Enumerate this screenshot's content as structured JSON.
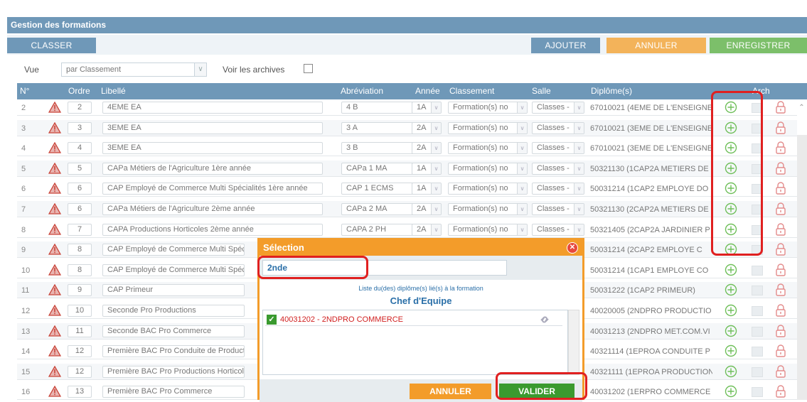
{
  "header": {
    "title": "Gestion des formations"
  },
  "toolbar": {
    "classer_label": "CLASSER",
    "ajouter_label": "AJOUTER",
    "annuler_label": "ANNULER",
    "enregistrer_label": "ENREGISTRER",
    "colors": {
      "classer": "#6f98b8",
      "ajouter": "#6f98b8",
      "annuler": "#f3b35a",
      "enregistrer": "#7cbf6a"
    }
  },
  "view": {
    "vue_label": "Vue",
    "vue_value": "par Classement",
    "archives_label": "Voir les archives",
    "archives_checked": false
  },
  "table": {
    "columns": [
      "N°",
      "Ordre",
      "Libellé",
      "Abréviation",
      "Année",
      "Classement",
      "Salle",
      "Diplôme(s)",
      "Arch"
    ],
    "rows": [
      {
        "n": "2",
        "ordre": "2",
        "libelle": "4EME EA",
        "abrev": "4 B",
        "annee": "1A",
        "classement": "Formation(s) no",
        "salle": "Classes -",
        "diplome": "67010021 (4EME DE L'ENSEIGNE"
      },
      {
        "n": "3",
        "ordre": "3",
        "libelle": "3EME EA",
        "abrev": "3 A",
        "annee": "2A",
        "classement": "Formation(s) no",
        "salle": "Classes -",
        "diplome": "67010021 (3EME DE L'ENSEIGNE"
      },
      {
        "n": "4",
        "ordre": "4",
        "libelle": "3EME EA",
        "abrev": "3 B",
        "annee": "2A",
        "classement": "Formation(s) no",
        "salle": "Classes -",
        "diplome": "67010021 (3EME DE L'ENSEIGNE"
      },
      {
        "n": "5",
        "ordre": "5",
        "libelle": "CAPa Métiers de l'Agriculture 1ère année",
        "abrev": "CAPa 1 MA",
        "annee": "1A",
        "classement": "Formation(s) no",
        "salle": "Classes -",
        "diplome": "50321130 (1CAP2A METIERS DE"
      },
      {
        "n": "6",
        "ordre": "6",
        "libelle": "CAP Employé de Commerce Multi Spécialités 1ère année",
        "abrev": "CAP 1 ECMS",
        "annee": "1A",
        "classement": "Formation(s) no",
        "salle": "Classes -",
        "diplome": "50031214 (1CAP2 EMPLOYE DO"
      },
      {
        "n": "7",
        "ordre": "6",
        "libelle": "CAPa Métiers de l'Agriculture 2ème année",
        "abrev": "CAPa 2 MA",
        "annee": "2A",
        "classement": "Formation(s) no",
        "salle": "Classes -",
        "diplome": "50321130 (2CAP2A METIERS DE"
      },
      {
        "n": "8",
        "ordre": "7",
        "libelle": "CAPA Productions Horticoles 2ème année",
        "abrev": "CAPA 2 PH",
        "annee": "2A",
        "classement": "Formation(s) no",
        "salle": "Classes -",
        "diplome": "50321405 (2CAP2A JARDINIER P"
      },
      {
        "n": "9",
        "ordre": "8",
        "libelle": "CAP Employé de Commerce Multi Spéci",
        "abrev": "",
        "annee": "",
        "classement": "",
        "salle": "",
        "diplome": "50031214 (2CAP2 EMPLOYE C"
      },
      {
        "n": "10",
        "ordre": "8",
        "libelle": "CAP Employé de Commerce Multi Spéci",
        "abrev": "",
        "annee": "",
        "classement": "",
        "salle": "",
        "diplome": "50031214 (1CAP1 EMPLOYE CO"
      },
      {
        "n": "11",
        "ordre": "9",
        "libelle": "CAP Primeur",
        "abrev": "",
        "annee": "",
        "classement": "",
        "salle": "",
        "diplome": "50031222 (1CAP2 PRIMEUR)"
      },
      {
        "n": "12",
        "ordre": "10",
        "libelle": "Seconde Pro Productions",
        "abrev": "",
        "annee": "",
        "classement": "",
        "salle": "",
        "diplome": "40020005 (2NDPRO PRODUCTIO"
      },
      {
        "n": "13",
        "ordre": "11",
        "libelle": "Seconde BAC Pro Commerce",
        "abrev": "",
        "annee": "",
        "classement": "",
        "salle": "",
        "diplome": "40031213 (2NDPRO MET.COM.VI"
      },
      {
        "n": "14",
        "ordre": "12",
        "libelle": "Première BAC Pro Conduite de Product",
        "abrev": "",
        "annee": "",
        "classement": "",
        "salle": "",
        "diplome": "40321114 (1EPROA CONDUITE P"
      },
      {
        "n": "15",
        "ordre": "12",
        "libelle": "Première BAC Pro Productions Horticol",
        "abrev": "",
        "annee": "",
        "classement": "",
        "salle": "",
        "diplome": "40321111 (1EPROA PRODUCTION"
      },
      {
        "n": "16",
        "ordre": "13",
        "libelle": "Première BAC Pro Commerce",
        "abrev": "",
        "annee": "",
        "classement": "",
        "salle": "",
        "diplome": "40031202 (1ERPRO COMMERCE"
      }
    ]
  },
  "modal": {
    "title": "Sélection",
    "search_value": "2nde",
    "subtitle": "Liste du(des) diplôme(s) lié(s) à la formation",
    "group": "Chef d'Equipe",
    "items": [
      {
        "label": "40031202 - 2NDPRO COMMERCE",
        "checked": true
      }
    ],
    "annuler_label": "ANNULER",
    "valider_label": "VALIDER"
  },
  "colors": {
    "accent": "#6f98b8",
    "modal_border": "#f39c2a",
    "highlight": "#e02020",
    "green": "#3a9a2f"
  }
}
